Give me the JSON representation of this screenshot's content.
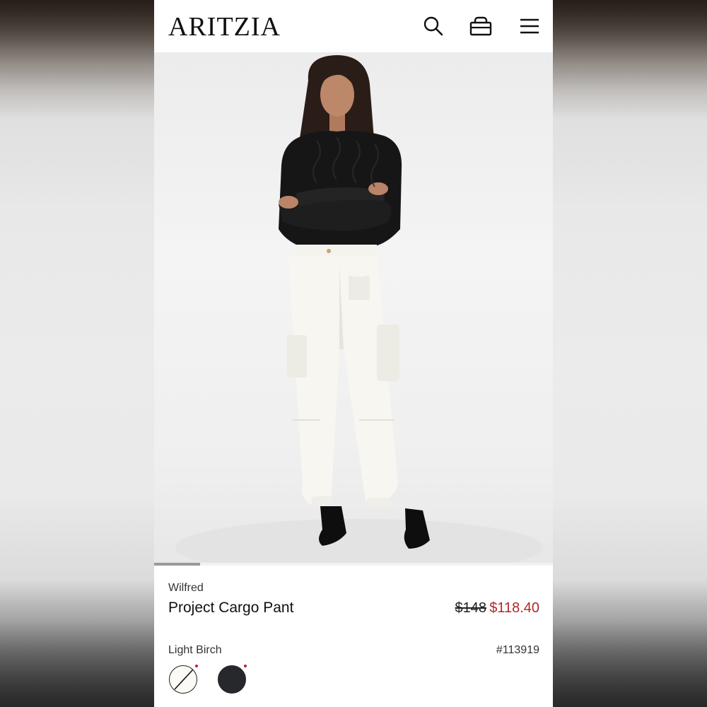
{
  "header": {
    "logo": "ARITZIA",
    "search_icon": "search-icon",
    "bag_icon": "shopping-bag-icon",
    "menu_icon": "hamburger-menu-icon"
  },
  "gallery": {
    "current_image": 1,
    "progress_fraction": 0.115
  },
  "product": {
    "brand": "Wilfred",
    "name": "Project Cargo Pant",
    "original_price": "$148",
    "sale_price": "$118.40",
    "selected_color": "Light Birch",
    "sku": "#113919",
    "swatches": [
      {
        "name": "Light Birch",
        "color": "#fbfaf6",
        "selected": true
      },
      {
        "name": "Black",
        "color": "#26282b",
        "selected": false
      }
    ]
  },
  "colors": {
    "sale": "#b3262c",
    "text": "#111111",
    "background": "#ffffff"
  }
}
